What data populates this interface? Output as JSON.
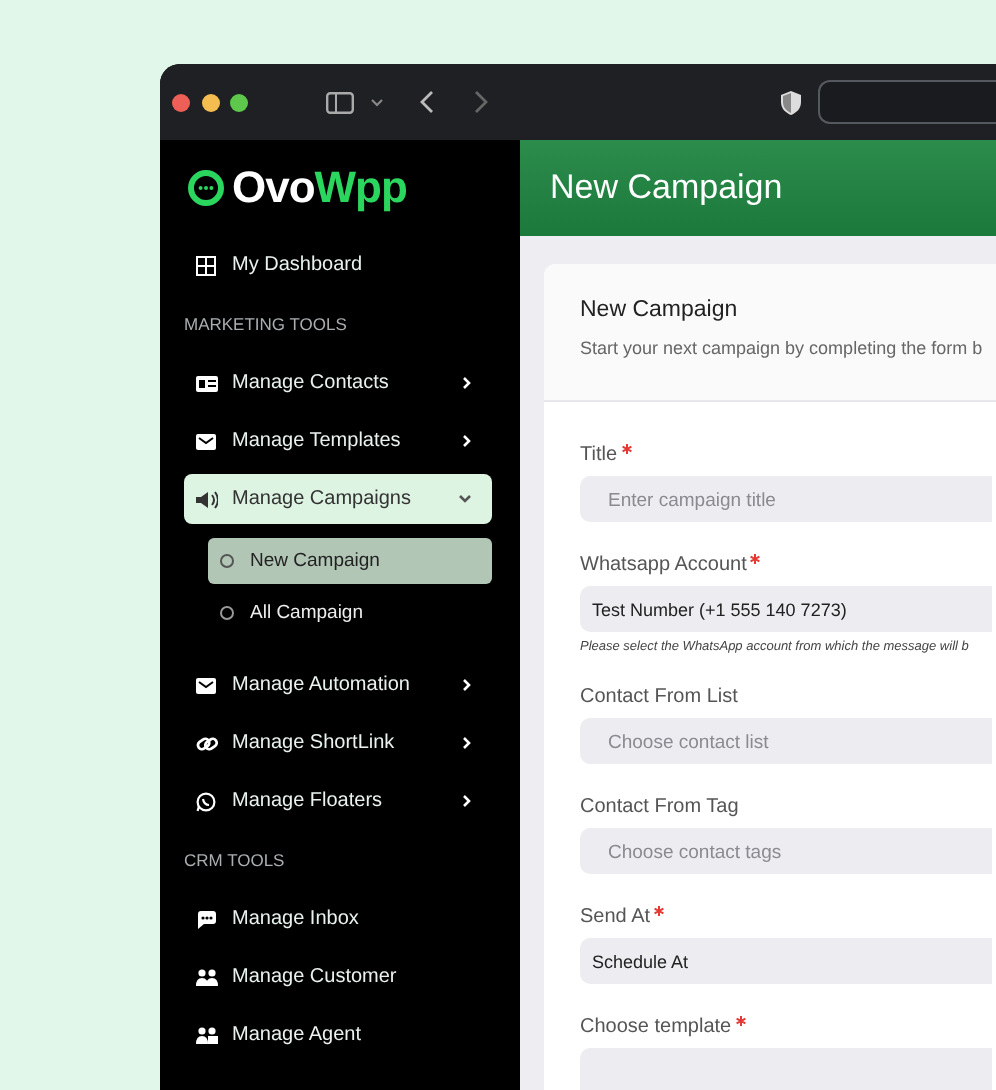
{
  "logo": {
    "prefix": "Ovo",
    "suffix": "Wpp"
  },
  "header": {
    "title": "New Campaign"
  },
  "sidebar": {
    "items": [
      {
        "kind": "link",
        "label": "My Dashboard"
      },
      {
        "kind": "section",
        "label": "MARKETING TOOLS"
      },
      {
        "kind": "group",
        "label": "Manage Contacts",
        "expanded": false
      },
      {
        "kind": "group",
        "label": "Manage Templates",
        "expanded": false
      },
      {
        "kind": "group",
        "label": "Manage Campaigns",
        "expanded": true,
        "children": [
          {
            "label": "New Campaign",
            "selected": true
          },
          {
            "label": "All Campaign",
            "selected": false
          }
        ]
      },
      {
        "kind": "group",
        "label": "Manage Automation",
        "expanded": false
      },
      {
        "kind": "group",
        "label": "Manage ShortLink",
        "expanded": false
      },
      {
        "kind": "group",
        "label": "Manage Floaters",
        "expanded": false
      },
      {
        "kind": "section",
        "label": "CRM TOOLS"
      },
      {
        "kind": "link",
        "label": "Manage Inbox"
      },
      {
        "kind": "link",
        "label": "Manage Customer"
      },
      {
        "kind": "link",
        "label": "Manage Agent"
      }
    ]
  },
  "card": {
    "title": "New Campaign",
    "subtitle": "Start your next campaign by completing the form b",
    "fields": [
      {
        "label": "Title",
        "required": true,
        "placeholder": "Enter campaign title"
      },
      {
        "label": "Whatsapp Account",
        "required": true,
        "value": "Test Number (+1 555 140 7273)",
        "hint": "Please select the WhatsApp account from which the message will b"
      },
      {
        "label": "Contact From List",
        "required": false,
        "placeholder": "Choose contact list"
      },
      {
        "label": "Contact From Tag",
        "required": false,
        "placeholder": "Choose contact tags"
      },
      {
        "label": "Send At",
        "required": true,
        "value": "Schedule At"
      },
      {
        "label": "Choose template",
        "required": true
      }
    ]
  }
}
